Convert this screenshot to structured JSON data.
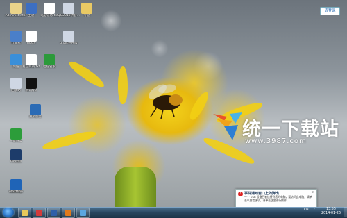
{
  "desktop": {
    "icons": [
      {
        "label": "Administrator",
        "color": "#e9d38a"
      },
      {
        "label": "主题",
        "color": "#3d6fc2"
      },
      {
        "label": "电脑信息.txt",
        "color": "#ffffff"
      },
      {
        "label": "QQ2013拼音...",
        "color": "#cfd7e4"
      },
      {
        "label": "专题",
        "color": "#e9c964"
      },
      {
        "label": "计算机",
        "color": "#4a7fc9"
      },
      {
        "label": "hosts",
        "color": "#ffffff"
      },
      {
        "label": "5.0软件升级",
        "color": "#cfd7e4"
      },
      {
        "label": "网络",
        "color": "#3a8fd9"
      },
      {
        "label": "打包目录.txt",
        "color": "#ffffff"
      },
      {
        "label": "电脑管家",
        "color": "#2b9a3a"
      },
      {
        "label": "回收站",
        "color": "#cfd7e4"
      },
      {
        "label": "腾讯QQ",
        "color": "#111111"
      },
      {
        "label": "暴风影音",
        "color": "#2b6bb5"
      },
      {
        "label": "一键恢复",
        "color": "#2c9d3a"
      },
      {
        "label": "Pinstall",
        "color": "#1d3c6a"
      },
      {
        "label": "Desktop",
        "color": "#3d7bd6"
      },
      {
        "label": "maxthon",
        "color": "#1f64b7"
      }
    ]
  },
  "watermark": {
    "title": "统一下载站",
    "url": "www.3987.com"
  },
  "qq_login": {
    "label": "请登录"
  },
  "notification": {
    "title": "事件通知窗口上的弹出",
    "text": "一个 USB 设备已被连接到您的电脑，要访问此电脑，请单击以查看选项，请单击这里进行操作。",
    "close": "x"
  },
  "taskbar": {
    "items": [
      {
        "name": "explorer",
        "color": "#e8c85a"
      },
      {
        "name": "media",
        "color": "#d33b3b"
      },
      {
        "name": "photoshop",
        "color": "#2e5fa8"
      },
      {
        "name": "firefox",
        "color": "#e07a1c"
      },
      {
        "name": "gallery",
        "color": "#5aa6e0"
      }
    ],
    "clock_time": "13:55",
    "clock_date": "2014-01-26",
    "tray_lang": "CH"
  }
}
